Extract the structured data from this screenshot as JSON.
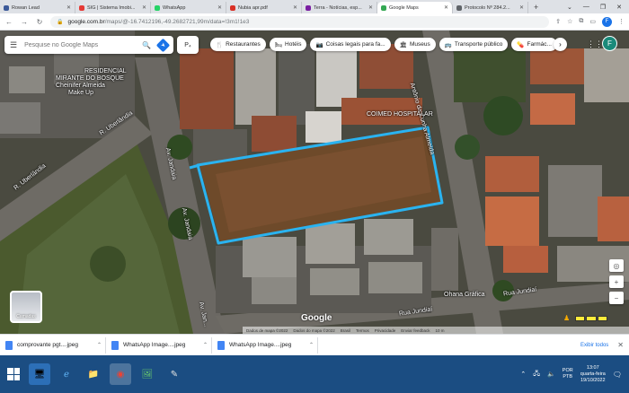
{
  "tabs": [
    {
      "title": "Rowan Lead",
      "color": "#3b5998",
      "active": false
    },
    {
      "title": "SIG | Sistema Imobi...",
      "color": "#e53935",
      "active": false
    },
    {
      "title": "WhatsApp",
      "color": "#25d366",
      "active": false
    },
    {
      "title": "Nubia apr.pdf",
      "color": "#d93025",
      "active": false
    },
    {
      "title": "Terra - Notícias, esp...",
      "color": "#7b1fa2",
      "active": false
    },
    {
      "title": "Google Maps",
      "color": "#34a853",
      "active": true
    },
    {
      "title": "Protocolo Nº 284.2...",
      "color": "#5f6368",
      "active": false
    }
  ],
  "address": {
    "domain": "google.com.br",
    "path": "/maps/@-16.7412196,-49.2682721,99m/data=!3m1!1e3"
  },
  "search": {
    "placeholder": "Pesquise no Google Maps",
    "p_label": "P₄"
  },
  "chips": [
    {
      "icon": "🍴",
      "icon_name": "restaurant-icon",
      "label": "Restaurantes"
    },
    {
      "icon": "🛏",
      "icon_name": "hotel-icon",
      "label": "Hotéis"
    },
    {
      "icon": "📷",
      "icon_name": "camera-icon",
      "label": "Coisas legais para fa..."
    },
    {
      "icon": "🏛",
      "icon_name": "museum-icon",
      "label": "Museus"
    },
    {
      "icon": "🚌",
      "icon_name": "bus-icon",
      "label": "Transporte público"
    },
    {
      "icon": "💊",
      "icon_name": "pharmacy-icon",
      "label": "Farmác..."
    }
  ],
  "avatar_letter": "F",
  "map_labels": {
    "residencial": "RESIDENCIAL",
    "mirante": "MIRANTE DO BOSQUE",
    "cheinifer": "Cheinifer Almeida",
    "make": "Make Up",
    "uberlandia1": "R. Uberlândia",
    "uberlandia2": "R. Uberlândia",
    "jandaia1": "Av. Jandaia",
    "jandaia2": "Av. Jandaia",
    "jandaia3": "Av. Jan...",
    "antonio": "Antônio da Cunha Almeida",
    "coimed": "COIMED HOSPITALAR",
    "ohana": "Ohana Gráfica",
    "jundiai1": "Rua Jundiaí",
    "jundiai2": "Rua Jundiaí"
  },
  "layers_label": "Camadas",
  "logo": "Google",
  "footer": [
    "Dados de mapa ©2022",
    "Dados do mapa ©2022",
    "Brasil",
    "Termos",
    "Privacidade",
    "Enviar feedback",
    "10 m"
  ],
  "downloads": [
    {
      "name": "comprovante pgt....jpeg"
    },
    {
      "name": "WhatsApp Image....jpeg"
    },
    {
      "name": "WhatsApp Image....jpeg"
    }
  ],
  "downloads_show_all": "Exibir todos",
  "taskbar": {
    "lang1": "POR",
    "lang2": "PTB",
    "time": "13:07",
    "day": "quarta-feira",
    "date": "19/10/2022"
  },
  "colors": {
    "highlight": "#2ab3f0",
    "accent": "#1a73e8",
    "taskbar": "#1b4d82"
  }
}
